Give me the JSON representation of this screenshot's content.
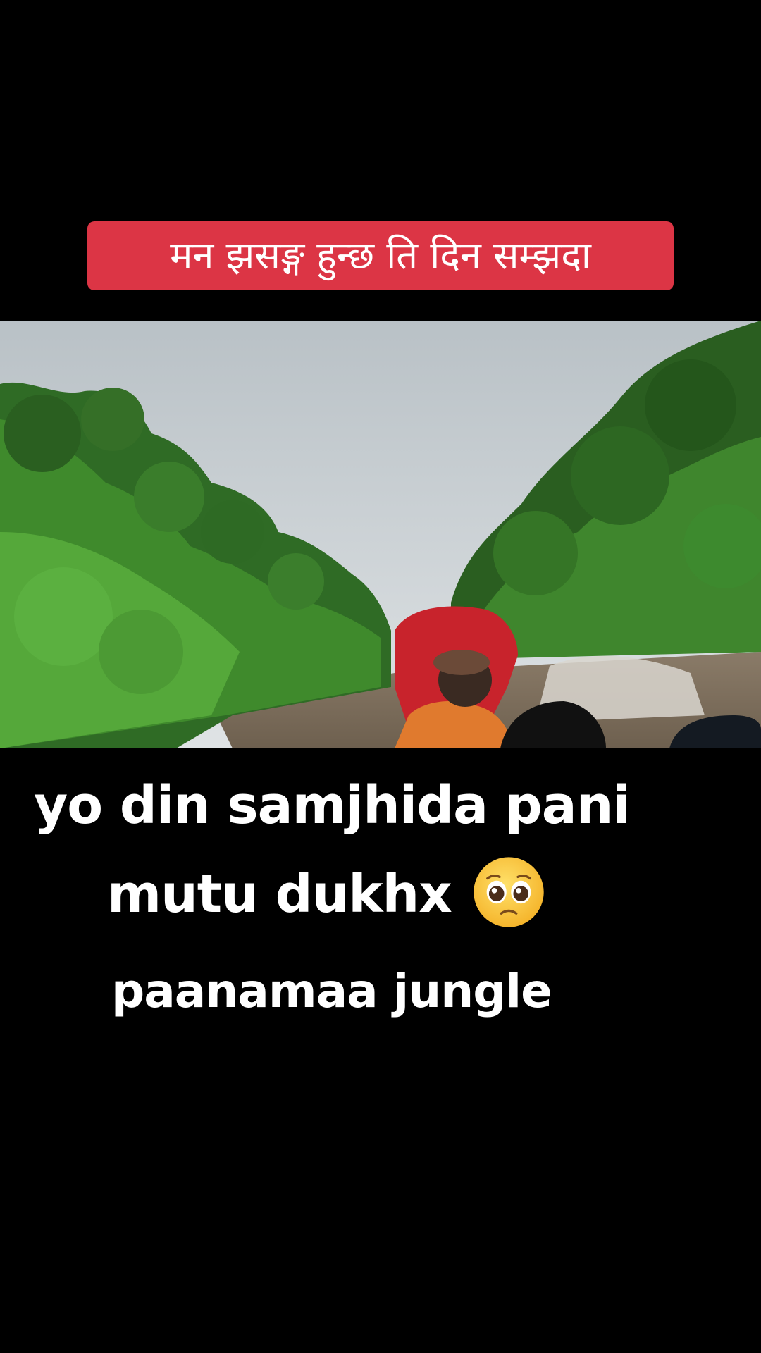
{
  "caption": {
    "text": "मन झसङ्ग हुन्छ ति दिन सम्झदा",
    "background_color": "#dc3545"
  },
  "video": {
    "scene": "river-boat-jungle"
  },
  "overlay": {
    "line1": "yo din samjhida pani",
    "line2": "mutu dukhx",
    "emoji": "pleading-face-emoji",
    "line3": "paanamaa jungle"
  }
}
